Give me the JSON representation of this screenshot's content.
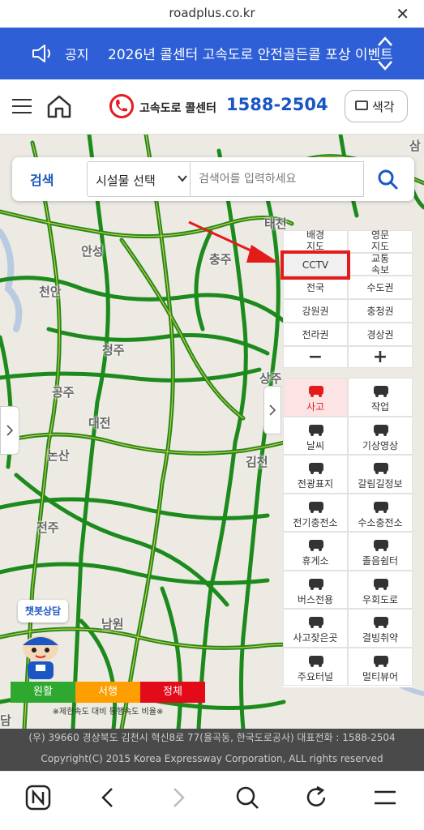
{
  "browser": {
    "url": "roadplus.co.kr",
    "close_icon": "close-icon"
  },
  "notice": {
    "label": "공지",
    "text": "2026년 콜센터 고속도로 안전골든콜 포상 이벤트",
    "bg": "#2f5fd6"
  },
  "header": {
    "callcenter_label": "고속도로 콜센터",
    "phone": "1588-2504",
    "color_button": "색각"
  },
  "search": {
    "tab": "검색",
    "facility_select": "시설물 선택",
    "placeholder": "검색어를 입력하세요"
  },
  "map_places": [
    "삼",
    "태천",
    "안성",
    "충주",
    "천안",
    "청주",
    "상주",
    "공주",
    "대전",
    "김천",
    "논산",
    "전주",
    "남원",
    "담"
  ],
  "map_panel": {
    "row1": [
      "배경\n지도",
      "영문\n지도"
    ],
    "row2": [
      "CCTV",
      "교통\n속보"
    ],
    "regions": [
      "전국",
      "수도권",
      "강원권",
      "충청권",
      "전라권",
      "경상권"
    ],
    "zoom_out": "−",
    "zoom_in": "+"
  },
  "layers": [
    {
      "label": "사고",
      "icon": "accident-car-icon"
    },
    {
      "label": "작업",
      "icon": "roadwork-icon"
    },
    {
      "label": "날씨",
      "icon": "weather-icon"
    },
    {
      "label": "기상영상",
      "icon": "satellite-icon"
    },
    {
      "label": "전광표지",
      "icon": "vms-icon"
    },
    {
      "label": "갈림길정보",
      "icon": "junction-icon"
    },
    {
      "label": "전기충전소",
      "icon": "ev-charger-icon"
    },
    {
      "label": "수소충전소",
      "icon": "hydrogen-station-icon"
    },
    {
      "label": "휴게소",
      "icon": "rest-area-icon"
    },
    {
      "label": "졸음쉼터",
      "icon": "parking-icon"
    },
    {
      "label": "버스전용",
      "icon": "bus-icon"
    },
    {
      "label": "우회도로",
      "icon": "detour-icon"
    },
    {
      "label": "사고잦은곳",
      "icon": "frequent-accident-icon"
    },
    {
      "label": "결빙취약",
      "icon": "icy-road-icon"
    },
    {
      "label": "주요터널",
      "icon": "tunnel-icon"
    },
    {
      "label": "멀티뷰어",
      "icon": "cctv-multiview-icon"
    }
  ],
  "chatbot": "챗봇상담",
  "legend": {
    "items": [
      {
        "label": "원활",
        "color": "#2ea82e"
      },
      {
        "label": "서행",
        "color": "#ff9e00"
      },
      {
        "label": "정체",
        "color": "#e30a1a"
      }
    ],
    "note": "※제한속도 대비 통행속도 비율※"
  },
  "footer": {
    "address": "(우) 39660 경상북도 김천시 혁신8로 77(율곡동, 한국도로공사) 대표전화 : 1588-2504",
    "copyright": "Copyright(C) 2015 Korea Expressway Corporation, ALL rights reserved"
  },
  "colors": {
    "brand_blue": "#1a57c4",
    "accent_red": "#e31b1b",
    "road_green": "#1c8a1c"
  }
}
